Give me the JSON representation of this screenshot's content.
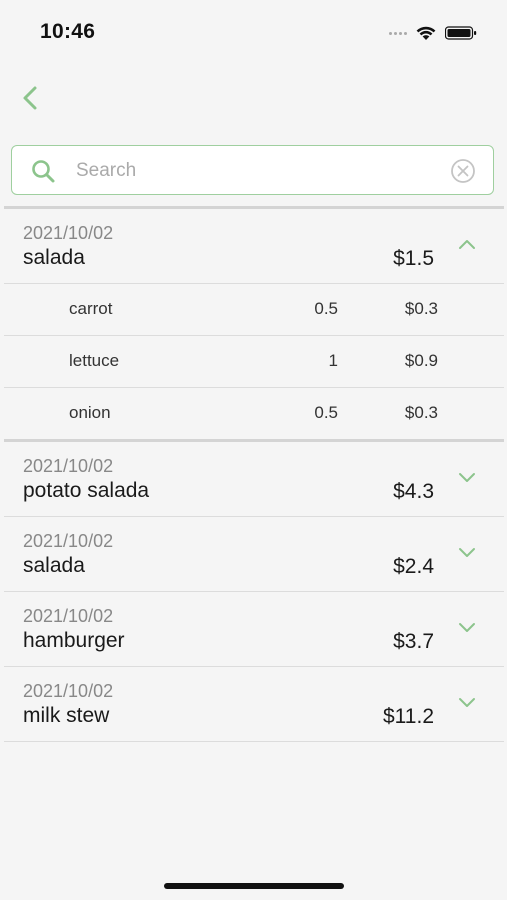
{
  "status_bar": {
    "time": "10:46"
  },
  "colors": {
    "accent": "#8cc48c",
    "border_green": "#9fcf9f",
    "background": "#f5f5f5"
  },
  "search": {
    "placeholder": "Search",
    "value": ""
  },
  "list": [
    {
      "date": "2021/10/02",
      "name": "salada",
      "price": "$1.5",
      "expanded": true,
      "items": [
        {
          "name": "carrot",
          "qty": "0.5",
          "price": "$0.3"
        },
        {
          "name": "lettuce",
          "qty": "1",
          "price": "$0.9"
        },
        {
          "name": "onion",
          "qty": "0.5",
          "price": "$0.3"
        }
      ]
    },
    {
      "date": "2021/10/02",
      "name": "potato salada",
      "price": "$4.3",
      "expanded": false
    },
    {
      "date": "2021/10/02",
      "name": "salada",
      "price": "$2.4",
      "expanded": false
    },
    {
      "date": "2021/10/02",
      "name": "hamburger",
      "price": "$3.7",
      "expanded": false
    },
    {
      "date": "2021/10/02",
      "name": "milk stew",
      "price": "$11.2",
      "expanded": false
    }
  ]
}
